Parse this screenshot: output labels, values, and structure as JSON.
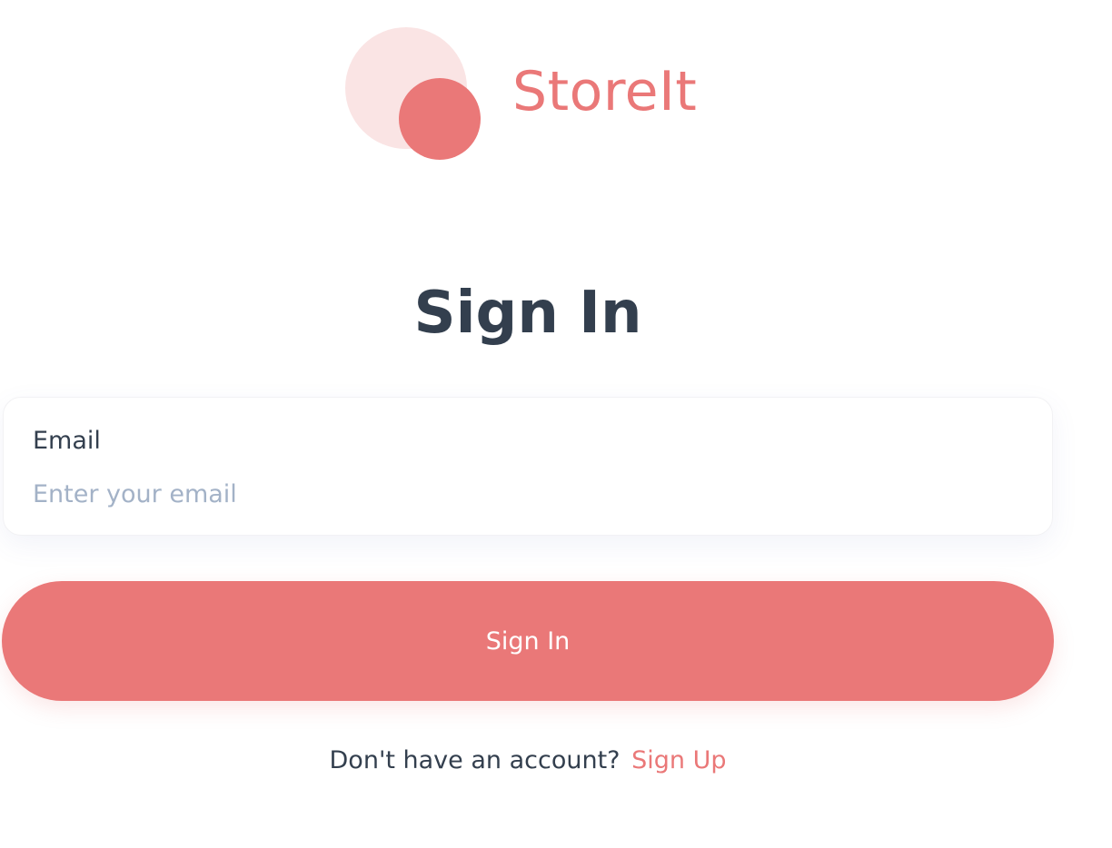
{
  "brand": {
    "name": "StoreIt",
    "color_primary": "#ea7878",
    "color_light": "#fae4e4"
  },
  "form": {
    "title": "Sign In",
    "email": {
      "label": "Email",
      "placeholder": "Enter your email",
      "value": ""
    },
    "submit_label": "Sign In"
  },
  "footer": {
    "prompt": "Don't have an account?",
    "link_label": "Sign Up"
  },
  "colors": {
    "text_dark": "#333f4e",
    "placeholder": "#a3b2c7",
    "background": "#ffffff"
  }
}
